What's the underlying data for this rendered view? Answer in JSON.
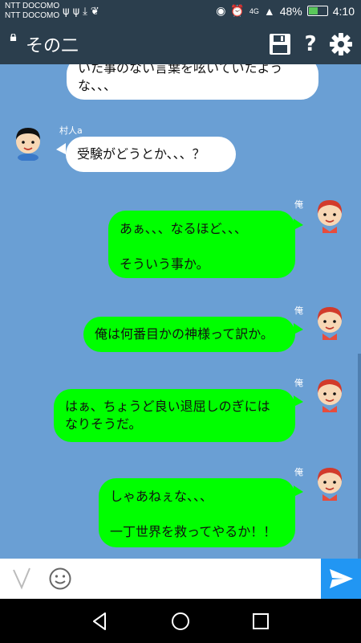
{
  "status_bar": {
    "carrier_line1": "NTT DOCOMO",
    "carrier_line2": "NTT DOCOMO",
    "network": "4G",
    "battery": "48%",
    "time": "4:10"
  },
  "app_bar": {
    "title": "その二",
    "icons": [
      "lock-icon",
      "save-icon",
      "help-icon",
      "settings-icon"
    ]
  },
  "messages": [
    {
      "side": "left",
      "speaker": "",
      "text": "いた事のない言葉を呟いていたよう\nな、、、"
    },
    {
      "side": "left",
      "speaker": "村人a",
      "text": "受験がどうとか、、、？"
    },
    {
      "side": "right",
      "speaker": "俺",
      "text": "あぁ、、、なるほど、、、\n\nそういう事か。"
    },
    {
      "side": "right",
      "speaker": "俺",
      "text": "俺は何番目かの神様って訳か。"
    },
    {
      "side": "right",
      "speaker": "俺",
      "text": "はぁ、ちょうど良い退屈しのぎには\nなりそうだ。"
    },
    {
      "side": "right",
      "speaker": "俺",
      "text": "しゃあねぇな、、、\n\n一丁世界を救ってやるか！！"
    }
  ],
  "input_bar": {
    "value": "",
    "icons": [
      "v-icon",
      "emoji-icon",
      "send-icon"
    ]
  },
  "nav_bar": {
    "icons": [
      "back-icon",
      "home-icon",
      "recents-icon"
    ]
  },
  "colors": {
    "background": "#6a9fd4",
    "toolbar": "#2b3e4d",
    "bubble_right": "#00ff00",
    "bubble_left": "#ffffff",
    "send": "#2196f3"
  }
}
